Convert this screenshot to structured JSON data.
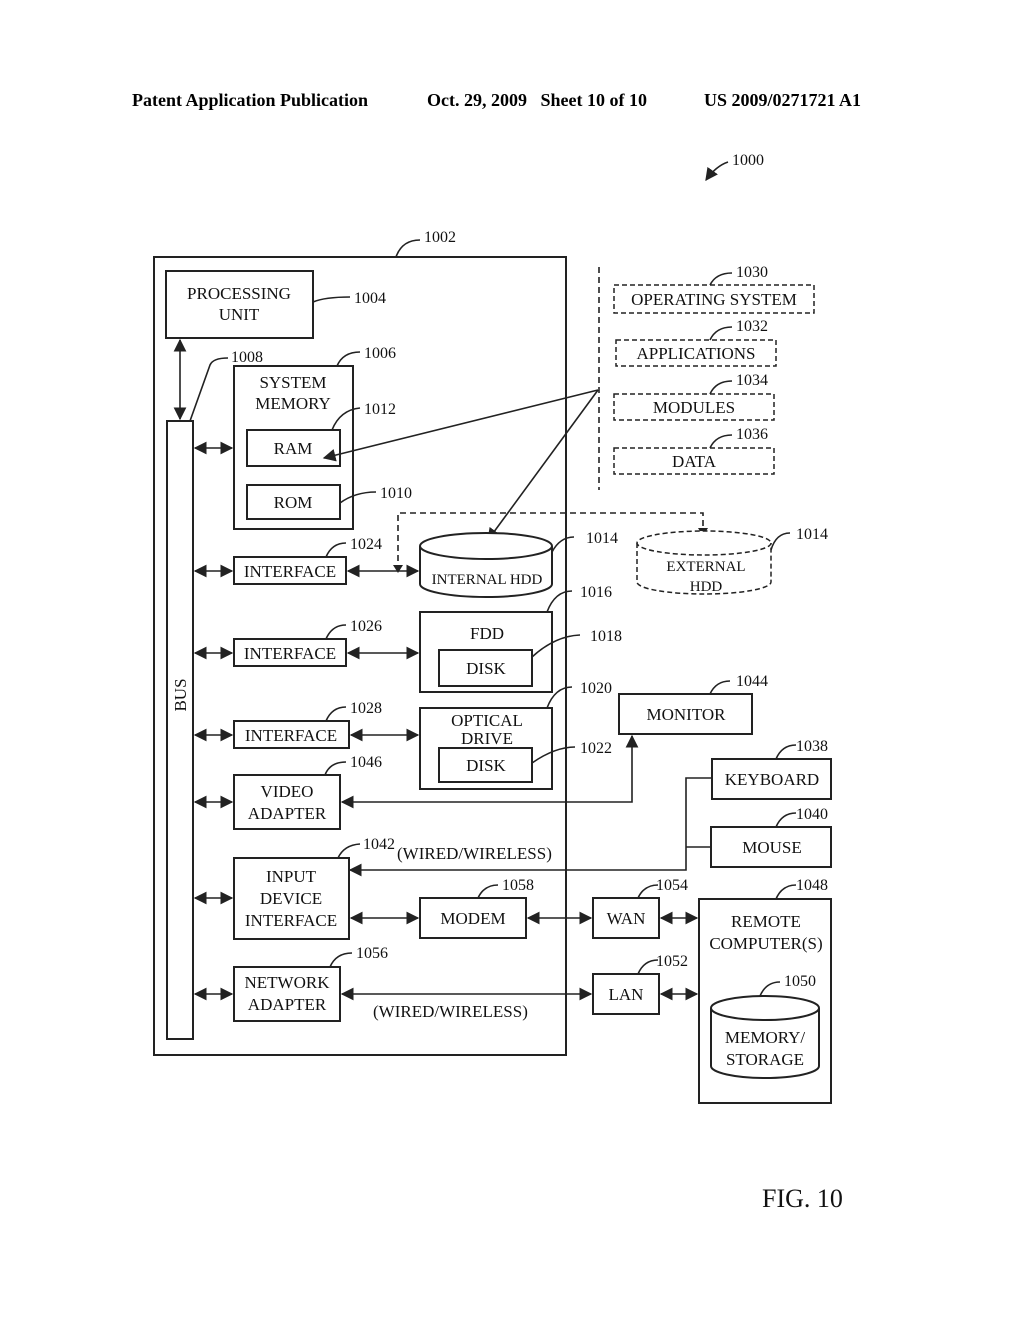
{
  "header": {
    "publication": "Patent Application Publication",
    "date_sheet": "Oct. 29, 2009   Sheet 10 of 10",
    "number": "US 2009/0271721 A1"
  },
  "figure": {
    "label": "FIG. 10",
    "ref_main": "1000",
    "computer_ref": "1002"
  },
  "blocks": {
    "processing_unit": {
      "line1": "PROCESSING",
      "line2": "UNIT",
      "ref": "1004"
    },
    "system_memory": {
      "line1": "SYSTEM",
      "line2": "MEMORY",
      "ref": "1006"
    },
    "bus": {
      "label": "BUS",
      "ref": "1008"
    },
    "ram": {
      "label": "RAM",
      "ref": "1012"
    },
    "rom": {
      "label": "ROM",
      "ref": "1010"
    },
    "interface_hdd": {
      "label": "INTERFACE",
      "ref": "1024"
    },
    "interface_fdd": {
      "label": "INTERFACE",
      "ref": "1026"
    },
    "interface_optical": {
      "label": "INTERFACE",
      "ref": "1028"
    },
    "internal_hdd": {
      "label": "INTERNAL HDD",
      "ref": "1014"
    },
    "external_hdd": {
      "line1": "EXTERNAL",
      "line2": "HDD",
      "ref": "1014"
    },
    "fdd": {
      "label": "FDD",
      "ref": "1016"
    },
    "fdd_disk": {
      "label": "DISK",
      "ref": "1018"
    },
    "optical_drive": {
      "line1": "OPTICAL",
      "line2": "DRIVE",
      "ref": "1020"
    },
    "optical_disk": {
      "label": "DISK",
      "ref": "1022"
    },
    "video_adapter": {
      "line1": "VIDEO",
      "line2": "ADAPTER",
      "ref": "1046"
    },
    "input_device_interface": {
      "line1": "INPUT",
      "line2": "DEVICE",
      "line3": "INTERFACE",
      "ref": "1042"
    },
    "network_adapter": {
      "line1": "NETWORK",
      "line2": "ADAPTER",
      "ref": "1056"
    },
    "modem": {
      "label": "MODEM",
      "ref": "1058"
    },
    "monitor": {
      "label": "MONITOR",
      "ref": "1044"
    },
    "keyboard": {
      "label": "KEYBOARD",
      "ref": "1038"
    },
    "mouse": {
      "label": "MOUSE",
      "ref": "1040"
    },
    "wan": {
      "label": "WAN",
      "ref": "1054"
    },
    "lan": {
      "label": "LAN",
      "ref": "1052"
    },
    "remote_computer": {
      "line1": "REMOTE",
      "line2": "COMPUTER(S)",
      "ref": "1048"
    },
    "remote_storage": {
      "line1": "MEMORY/",
      "line2": "STORAGE",
      "ref": "1050"
    },
    "operating_system": {
      "label": "OPERATING SYSTEM",
      "ref": "1030"
    },
    "applications": {
      "label": "APPLICATIONS",
      "ref": "1032"
    },
    "modules": {
      "label": "MODULES",
      "ref": "1034"
    },
    "data": {
      "label": "DATA",
      "ref": "1036"
    }
  },
  "annotations": {
    "wired_wireless_input": "(WIRED/WIRELESS)",
    "wired_wireless_network": "(WIRED/WIRELESS)"
  }
}
